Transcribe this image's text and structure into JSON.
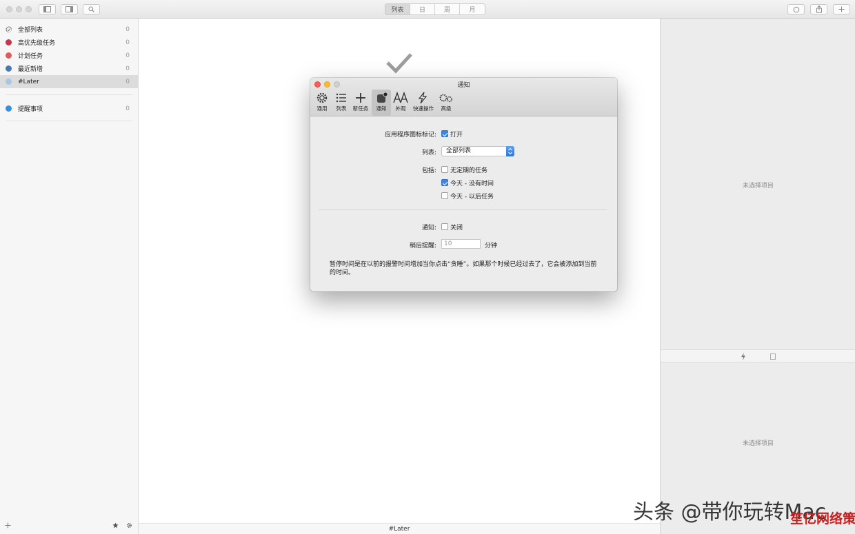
{
  "toolbar": {
    "views": [
      {
        "label": "列表",
        "active": true
      },
      {
        "label": "日",
        "active": false
      },
      {
        "label": "周",
        "active": false
      },
      {
        "label": "月",
        "active": false
      }
    ]
  },
  "sidebar": {
    "items": [
      {
        "label": "全部列表",
        "count": "0",
        "color": "#777777",
        "icon": "check-circle-icon"
      },
      {
        "label": "高优先级任务",
        "count": "0",
        "color": "#c8344c"
      },
      {
        "label": "计划任务",
        "count": "0",
        "color": "#e25b5b"
      },
      {
        "label": "最近新增",
        "count": "0",
        "color": "#4a78b0"
      },
      {
        "label": "#Later",
        "count": "0",
        "color": "#a7c7e2",
        "selected": true
      },
      {
        "label": "提醒事项",
        "count": "0",
        "color": "#3a8fdc"
      }
    ]
  },
  "main": {
    "footer_label": "#Later"
  },
  "right_pane": {
    "top_empty": "未选择项目",
    "bottom_empty": "未选择项目"
  },
  "dialog": {
    "title": "通知",
    "tools": [
      {
        "label": "通用",
        "icon": "gear-icon"
      },
      {
        "label": "列表",
        "icon": "list-icon"
      },
      {
        "label": "新任务",
        "icon": "plus-icon"
      },
      {
        "label": "通知",
        "icon": "notification-badge-icon",
        "active": true
      },
      {
        "label": "外观",
        "icon": "font-aa-icon"
      },
      {
        "label": "快速操作",
        "icon": "lightning-icon"
      },
      {
        "label": "高级",
        "icon": "advanced-gears-icon"
      }
    ],
    "badge_label": "应用程序图标标记:",
    "badge_value": "打开",
    "list_label": "列表:",
    "list_value": "全部列表",
    "include_label": "包括:",
    "include_options": [
      {
        "label": "无定期的任务",
        "checked": false
      },
      {
        "label": "今天 - 没有时间",
        "checked": true
      },
      {
        "label": "今天 - 以后任务",
        "checked": false
      }
    ],
    "notify_label": "通知:",
    "notify_value": "关闭",
    "snooze_label": "稍后提醒:",
    "snooze_value": "10",
    "snooze_unit": "分钟",
    "description": "暂停时间是在以前的报警时间增加当你点击“贪睡”。如果那个时候已经过去了，它会被添加到当前的时间。"
  },
  "watermark": {
    "text": "头条 @带你玩转Mac",
    "sub": "笙亿网络策划"
  }
}
